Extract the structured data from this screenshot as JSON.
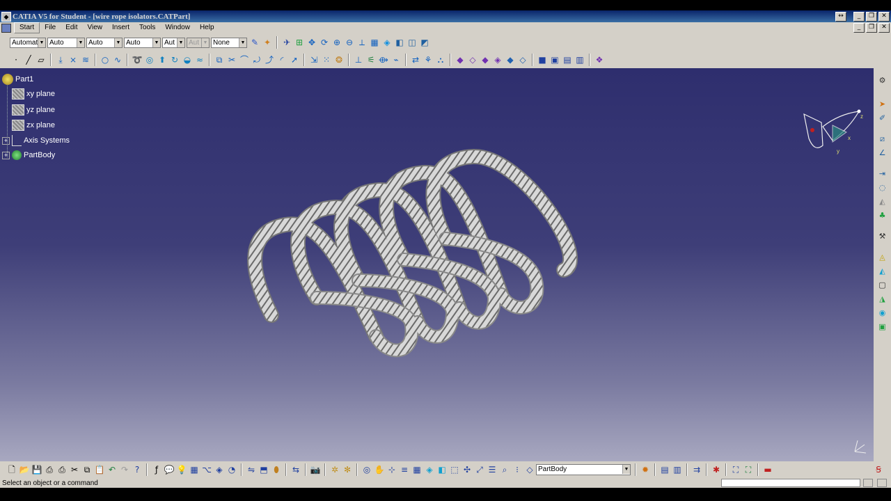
{
  "window": {
    "title": "CATIA V5 for Student - [wire rope isolators.CATPart]",
    "controls": {
      "resize": "↔",
      "minimize": "_",
      "restore": "❐",
      "close": "✕"
    }
  },
  "menu": {
    "items": [
      "Start",
      "File",
      "Edit",
      "View",
      "Insert",
      "Tools",
      "Window",
      "Help"
    ],
    "active": "Start"
  },
  "toolbar": {
    "selects": [
      {
        "value": "Automat",
        "disabled": false
      },
      {
        "value": "Auto",
        "disabled": false
      },
      {
        "value": "Auto",
        "disabled": false
      },
      {
        "value": "Auto",
        "disabled": false
      },
      {
        "value": "Aut",
        "disabled": false
      },
      {
        "value": "Aut",
        "disabled": true
      },
      {
        "value": "None",
        "disabled": false
      }
    ]
  },
  "tree": {
    "root": "Part1",
    "items": [
      {
        "label": "xy plane",
        "icon": "plane-icon"
      },
      {
        "label": "yz plane",
        "icon": "plane-icon"
      },
      {
        "label": "zx plane",
        "icon": "plane-icon"
      },
      {
        "label": "Axis Systems",
        "icon": "axis-system-icon"
      },
      {
        "label": "PartBody",
        "icon": "partbody-icon"
      }
    ]
  },
  "compass": {
    "x": "x",
    "y": "y",
    "z": "z"
  },
  "model": {
    "description_icon": "helical-wire-rope-spring"
  },
  "bottom_toolbar": {
    "current_body": "PartBody"
  },
  "status": {
    "message": "Select an object or a command"
  },
  "colors": {
    "viewport_top": "#2e2e6e",
    "viewport_bottom": "#a8a8c0",
    "chrome": "#d4d0c8",
    "titlebar": "#0a246a"
  }
}
